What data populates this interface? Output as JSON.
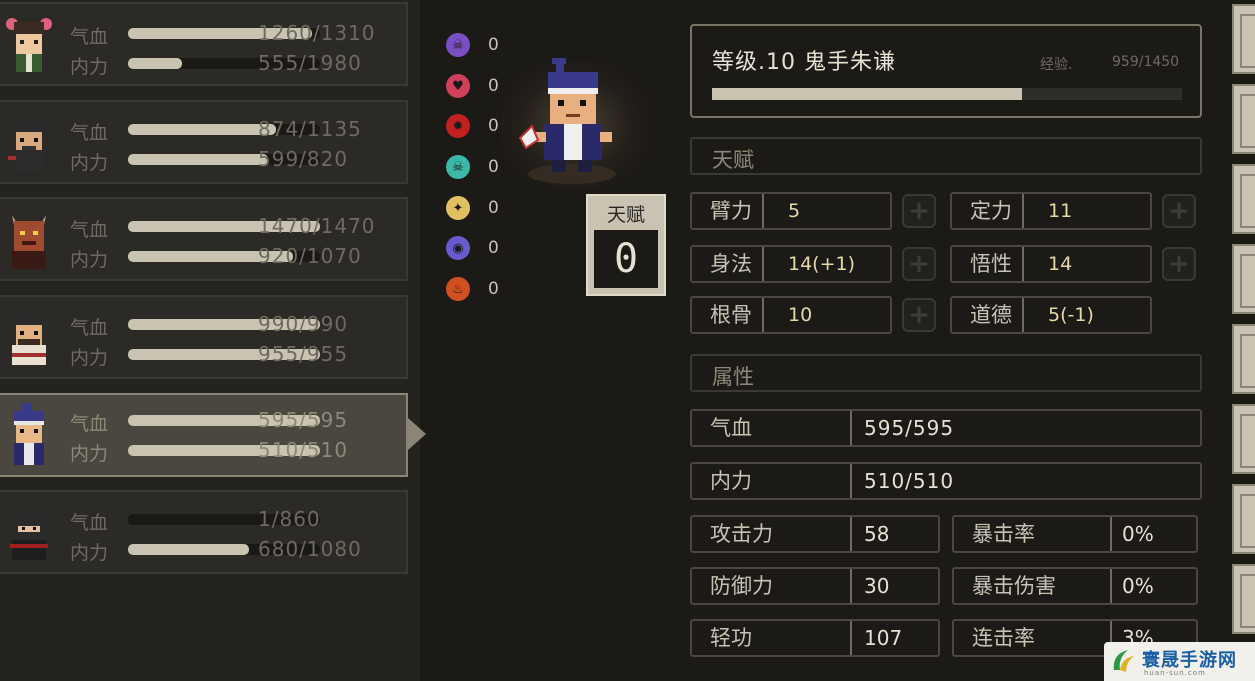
{
  "party": [
    {
      "hp_label": "气血",
      "hp": "1260/1310",
      "hp_fill": 0.96,
      "mp_label": "内力",
      "mp": "555/1980",
      "mp_fill": 0.28
    },
    {
      "hp_label": "气血",
      "hp": "874/1135",
      "hp_fill": 0.77,
      "mp_label": "内力",
      "mp": "599/820",
      "mp_fill": 0.73
    },
    {
      "hp_label": "气血",
      "hp": "1470/1470",
      "hp_fill": 1.0,
      "mp_label": "内力",
      "mp": "920/1070",
      "mp_fill": 0.86
    },
    {
      "hp_label": "气血",
      "hp": "990/990",
      "hp_fill": 1.0,
      "mp_label": "内力",
      "mp": "955/955",
      "mp_fill": 1.0
    },
    {
      "hp_label": "气血",
      "hp": "595/595",
      "hp_fill": 1.0,
      "mp_label": "内力",
      "mp": "510/510",
      "mp_fill": 1.0,
      "selected": true
    },
    {
      "hp_label": "气血",
      "hp": "1/860",
      "hp_fill": 0.0,
      "mp_label": "内力",
      "mp": "680/1080",
      "mp_fill": 0.63
    }
  ],
  "status_effects": [
    {
      "icon": "skull-icon",
      "color": "#7b4fc4",
      "count": "0"
    },
    {
      "icon": "broken-heart-icon",
      "color": "#d0405a",
      "count": "0"
    },
    {
      "icon": "blood-splat-icon",
      "color": "#c02020",
      "count": "0"
    },
    {
      "icon": "poison-skull-icon",
      "color": "#3ab8a8",
      "count": "0"
    },
    {
      "icon": "stun-icon",
      "color": "#e0c060",
      "count": "0"
    },
    {
      "icon": "confusion-icon",
      "color": "#6a5ad0",
      "count": "0"
    },
    {
      "icon": "fire-icon",
      "color": "#d05020",
      "count": "0"
    }
  ],
  "talent": {
    "label": "天赋",
    "points": "0"
  },
  "character": {
    "title": "等级.10 鬼手朱谦",
    "exp_label": "经验.",
    "exp_value": "959/1450",
    "exp_fill": 0.66
  },
  "talent_section": {
    "label": "天赋"
  },
  "attributes": [
    {
      "name": "臂力",
      "value": "5"
    },
    {
      "name": "定力",
      "value": "11"
    },
    {
      "name": "身法",
      "value": "14(+1)"
    },
    {
      "name": "悟性",
      "value": "14"
    },
    {
      "name": "根骨",
      "value": "10"
    },
    {
      "name": "道德",
      "value": "5(-1)"
    }
  ],
  "property_section": {
    "label": "属性"
  },
  "properties": {
    "hp": {
      "name": "气血",
      "value": "595/595"
    },
    "mp": {
      "name": "内力",
      "value": "510/510"
    },
    "attack": {
      "name": "攻击力",
      "value": "58"
    },
    "crit_rate": {
      "name": "暴击率",
      "value": "0%"
    },
    "defense": {
      "name": "防御力",
      "value": "30"
    },
    "crit_damage": {
      "name": "暴击伤害",
      "value": "0%"
    },
    "agility": {
      "name": "轻功",
      "value": "107"
    },
    "combo_rate": {
      "name": "连击率",
      "value": "3%"
    }
  },
  "watermark": {
    "name": "寰晟手游网",
    "url": "huan-sun.com"
  }
}
